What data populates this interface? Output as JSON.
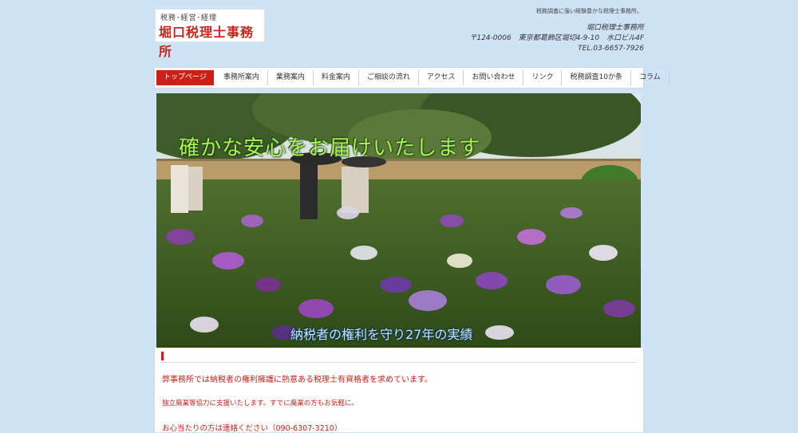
{
  "header": {
    "logo_sub": "税務･経営･経理",
    "logo_main": "堀口税理士事務所",
    "tagline": "税務調査に強い経験豊かな税理士事務所。",
    "address": {
      "office": "堀口税理士事務所",
      "postal": "〒124-0006　東京都葛飾区堀切4-9-10　水口ビル4F",
      "tel": "TEL.03-6657-7926"
    }
  },
  "nav": {
    "items": [
      {
        "label": "トップページ"
      },
      {
        "label": "事務所案内"
      },
      {
        "label": "業務案内"
      },
      {
        "label": "料金案内"
      },
      {
        "label": "ご相談の流れ"
      },
      {
        "label": "アクセス"
      },
      {
        "label": "お問い合わせ"
      },
      {
        "label": "リンク"
      },
      {
        "label": "税務調査10か条"
      },
      {
        "label": "コラム"
      }
    ]
  },
  "hero": {
    "title": "確かな安心をお届けいたします",
    "caption": "納税者の権利を守り27年の実績"
  },
  "content": {
    "message1": "弊事務所では納税者の権利擁護に熱意ある税理士有資格者を求めています。",
    "message2": "独立廃業等協力に支援いたします。すでに廃業の方もお気軽に。",
    "message3": "お心当たりの方は連絡ください（090-6307-3210）"
  },
  "colors": {
    "background": "#cfe3f7",
    "accent": "#cc1f18",
    "hero_title": "#a8f25a",
    "hero_caption": "#bfe8ff"
  }
}
